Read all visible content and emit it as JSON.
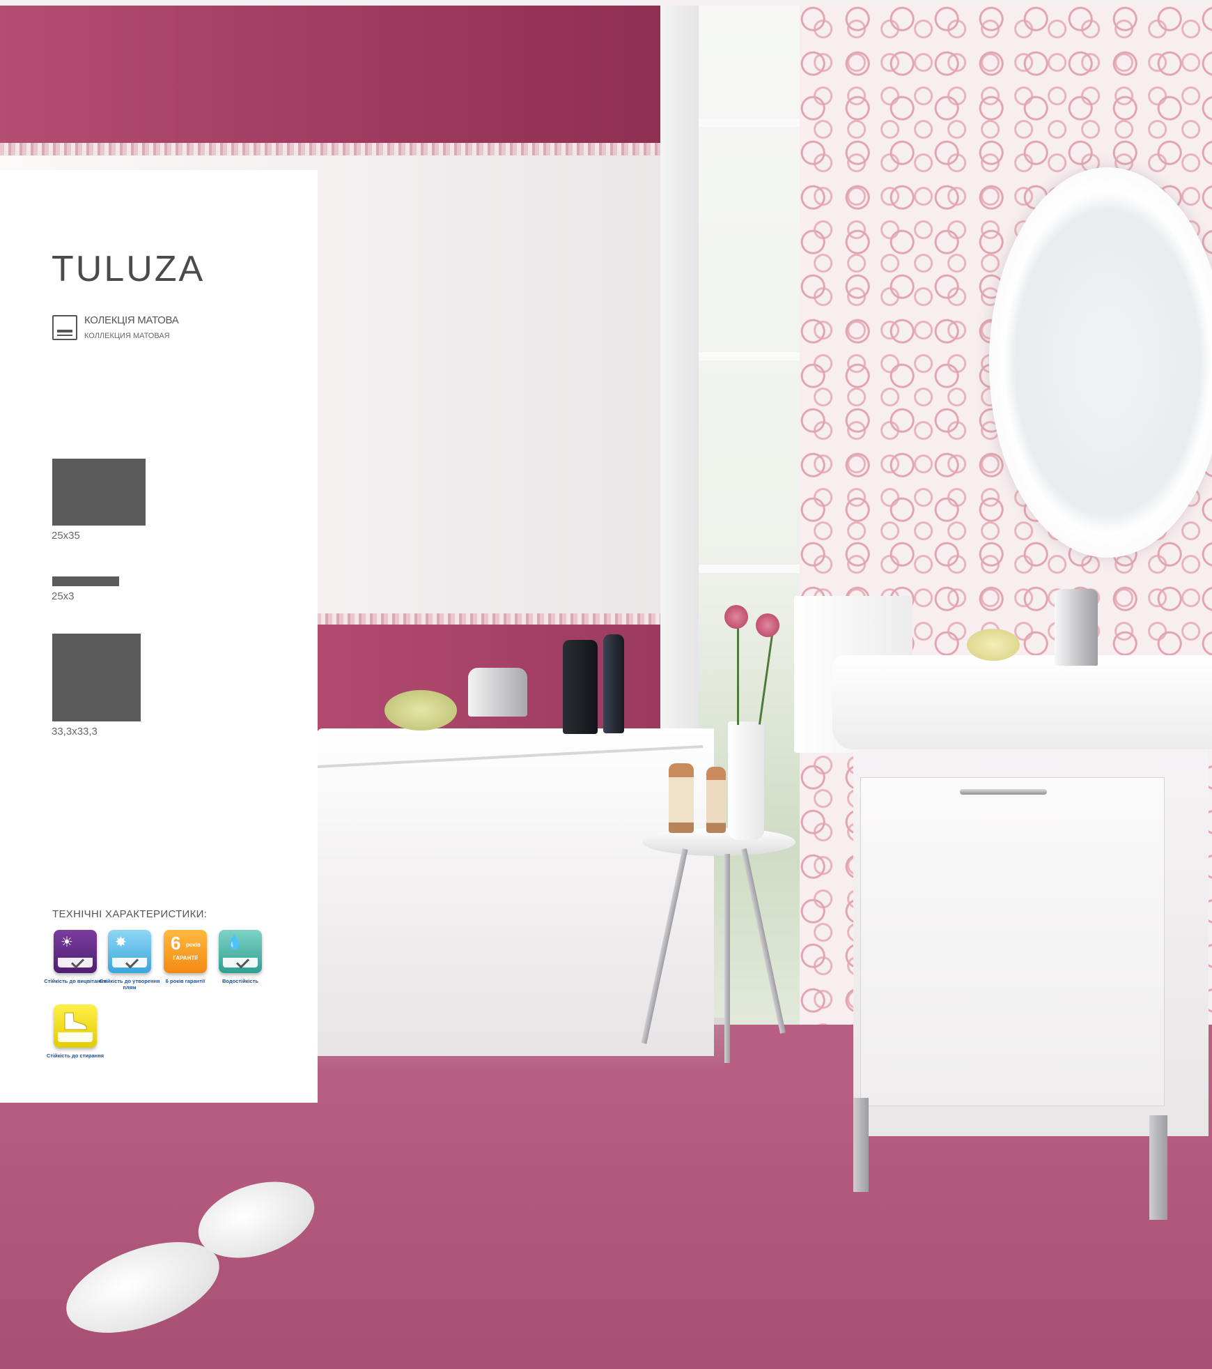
{
  "collection": {
    "title": "TULUZA",
    "finish_ua": "КОЛЕКЦІЯ МАТОВА",
    "finish_ru": "КОЛЛЕКЦИЯ МАТОВАЯ"
  },
  "tiles": [
    {
      "size": "25x35",
      "color": "#5b5b5b"
    },
    {
      "size": "25x3",
      "color": "#5b5b5b"
    },
    {
      "size": "33,3x33,3",
      "color": "#5b5b5b"
    }
  ],
  "tech": {
    "heading": "ТЕХНІЧНІ ХАРАКТЕРИСТИКИ:",
    "features": [
      {
        "icon": "sun-fade-icon",
        "label": "Стійкість до вицвітання",
        "color": "#5a2580"
      },
      {
        "icon": "stain-icon",
        "label": "Стійкість до утворення плям",
        "color": "#4fb6e6"
      },
      {
        "icon": "warranty-icon",
        "label": "6 років гарантії",
        "color": "#f59a1e",
        "badge_number": "6",
        "badge_years": "років",
        "badge_word": "ГАРАНТІЇ"
      },
      {
        "icon": "water-drop-icon",
        "label": "Водостійкість",
        "color": "#3fb0a3"
      },
      {
        "icon": "boot-icon",
        "label": "Стійкість до стирання",
        "color": "#f0db10"
      }
    ]
  }
}
